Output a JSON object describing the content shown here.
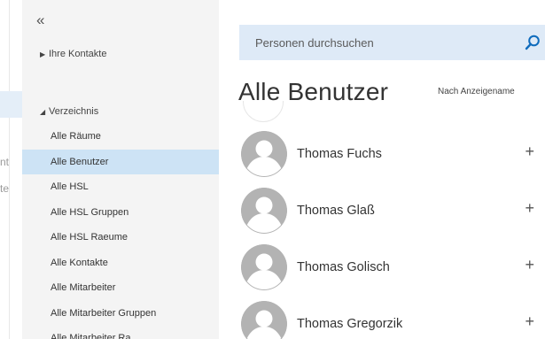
{
  "left_strip": {
    "fragment_1": "nt",
    "fragment_2": "te"
  },
  "sidebar": {
    "collapse_glyph": "«",
    "contacts_node": "Ihre Kontakte",
    "directory_node": "Verzeichnis",
    "items": [
      {
        "label": "Alle Räume"
      },
      {
        "label": "Alle Benutzer",
        "active": true
      },
      {
        "label": "Alle HSL"
      },
      {
        "label": "Alle HSL Gruppen"
      },
      {
        "label": "Alle HSL Raeume"
      },
      {
        "label": "Alle Kontakte"
      },
      {
        "label": "Alle Mitarbeiter"
      },
      {
        "label": "Alle Mitarbeiter Gruppen"
      },
      {
        "label": "Alle Mitarbeiter Ra"
      }
    ]
  },
  "search": {
    "placeholder": "Personen durchsuchen",
    "icon": "search-icon"
  },
  "main": {
    "title": "Alle Benutzer",
    "sort_label": "Nach Anzeigename"
  },
  "people": [
    {
      "name": "Thomas Fuchs",
      "action": "+"
    },
    {
      "name": "Thomas Glaß",
      "action": "+"
    },
    {
      "name": "Thomas Golisch",
      "action": "+"
    },
    {
      "name": "Thomas Gregorzik",
      "action": "+"
    }
  ],
  "colors": {
    "accent": "#0f6cbd",
    "selection": "#cde3f5",
    "search_bg": "#deeaf7",
    "avatar": "#b3b3b3"
  }
}
